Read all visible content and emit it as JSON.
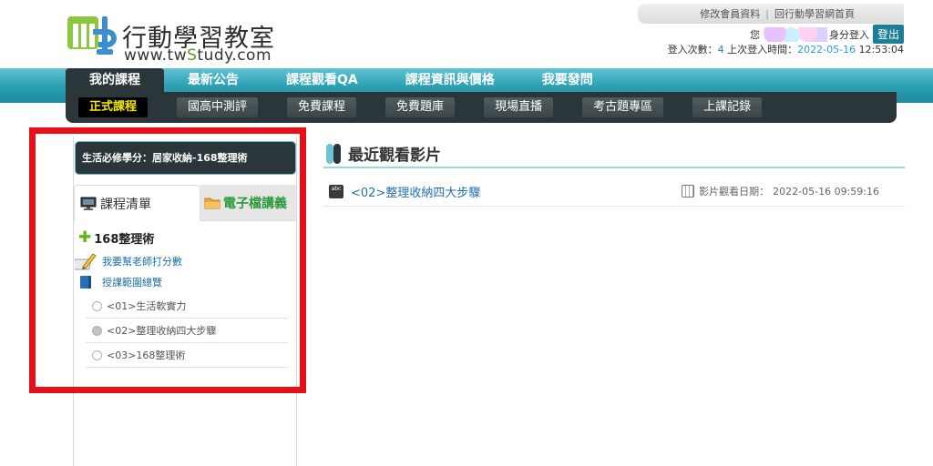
{
  "brand": {
    "title": "行動學習教室",
    "url_prefix": "www.tw",
    "url_highlight": "S",
    "url_suffix": "tudy.com"
  },
  "top_links": {
    "edit_profile": "修改會員資料",
    "separator": "|",
    "home": "回行動學習網首頁"
  },
  "user": {
    "prefix": "您",
    "suffix": "身分登入",
    "logout": "登出",
    "login_count_label": "登入次數：",
    "login_count": "4",
    "last_login_label": "上次登入時間：",
    "last_login_date": "2022-05-16",
    "last_login_time": "12:53:04"
  },
  "nav": {
    "tabs": [
      "我的課程",
      "最新公告",
      "課程觀看QA",
      "課程資訊與價格",
      "我要發問"
    ],
    "active_tab": "我的課程",
    "sub_items": [
      "正式課程",
      "國高中測評",
      "免費課程",
      "免費題庫",
      "現場直播",
      "考古題專區",
      "上課記錄"
    ],
    "active_sub": "正式課程"
  },
  "sidebar": {
    "course_header": "生活必修學分：居家收納-168整理術",
    "tab_list": "課程清單",
    "tab_handout": "電子檔講義",
    "lesson_title": "168整理術",
    "rate_teacher": "我要幫老師打分數",
    "syllabus": "授課範圍總覽",
    "units": [
      {
        "label": "<01>生活軟實力",
        "state": "empty"
      },
      {
        "label": "<02>整理收納四大步驟",
        "state": "watched"
      },
      {
        "label": "<03>168整理術",
        "state": "empty"
      }
    ]
  },
  "main": {
    "section_title": "最近觀看影片",
    "recent_video": "<02>整理收納四大步驟",
    "watch_date_label": "影片觀看日期：",
    "watch_date": "2022-05-16 09:59:16"
  },
  "colors": {
    "nav_teal": "#2b9eb2",
    "dark_bar": "#2a3639",
    "active_sub_text": "#f2e600",
    "highlight_red": "#e8101b",
    "link_blue": "#1f6fb0",
    "handout_green": "#2c9a3a"
  },
  "icons": [
    "logo-mark-icon",
    "monitor-icon",
    "folder-icon",
    "plus-icon",
    "pen-paper-icon",
    "book-icon",
    "radio-icon",
    "video-icon",
    "calendar-icon",
    "title-bar-icon"
  ]
}
